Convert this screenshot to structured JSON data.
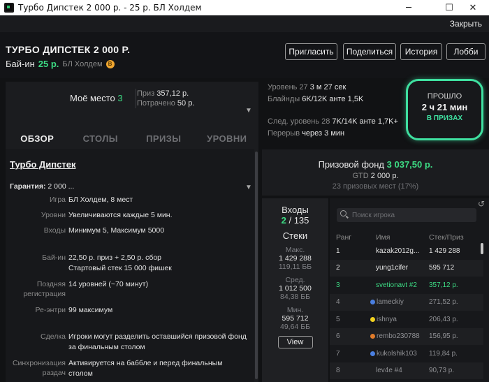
{
  "window": {
    "title": "Турбо Дипстек 2 000 р. - 25 р. БЛ Холдем",
    "min_symbol": "─",
    "max_symbol": "☐",
    "close_symbol": "✕"
  },
  "topbar": {
    "close_label": "Закрыть"
  },
  "header": {
    "title": "ТУРБО ДИПСТЕК 2 000 Р.",
    "buyin_label": "Бай-ин",
    "buyin_amount": "25 р.",
    "game": "БЛ Холдем",
    "coin_symbol": "B",
    "buttons": {
      "invite": "Пригласить",
      "share": "Поделиться",
      "history": "История",
      "lobby": "Лобби"
    }
  },
  "my_place": {
    "label": "Моё место",
    "place": "3",
    "prize_label": "Приз",
    "prize_value": "357,12 р.",
    "spent_label": "Потрачено",
    "spent_value": "50 р."
  },
  "tabs": [
    {
      "label": "ОБЗОР",
      "active": true
    },
    {
      "label": "СТОЛЫ",
      "active": false
    },
    {
      "label": "ПРИЗЫ",
      "active": false
    },
    {
      "label": "УРОВНИ",
      "active": false
    }
  ],
  "overview": {
    "title": "Турбо Дипстек",
    "guarantee_label": "Гарантия:",
    "guarantee_value": "2 000 ...",
    "rows": [
      {
        "key": "Игра",
        "value": "БЛ Холдем, 8 мест"
      },
      {
        "key": "Уровни",
        "value": "Увеличиваются каждые 5 мин."
      },
      {
        "key": "Входы",
        "value": "Минимум 5, Максимум 5000"
      },
      {
        "key": "Бай-ин",
        "value": "22,50 р. приз + 2,50 р. сбор",
        "value2": "Стартовый стек 15 000 фишек"
      },
      {
        "key": "Поздняя",
        "key2": "регистрация",
        "value": "14 уровней (~70 минут)"
      },
      {
        "key": "Ре-энтри",
        "value": "99 максимум"
      },
      {
        "key": "Сделка",
        "value": "Игроки могут разделить оставшийся призовой фонд",
        "value2": "за финальным столом"
      },
      {
        "key": "Синхронизация",
        "key2": "раздач",
        "value": "Активируется на баббле и перед финальным",
        "value2": "столом"
      }
    ]
  },
  "level_info": {
    "level_label": "Уровень",
    "level_num": "27",
    "level_time": "3 м 27 сек",
    "blinds_label": "Блайнды",
    "blinds_value": "6K/12K анте 1,5K",
    "next_label": "След. уровень",
    "next_num": "28",
    "next_value": "7K/14K анте 1,7K+",
    "break_label": "Перерыв",
    "break_value": "через 3 мин"
  },
  "elapsed": {
    "label": "ПРОШЛО",
    "time": "2 ч 21 мин",
    "status": "В ПРИЗАХ",
    "ring_color": "#3fe0a0"
  },
  "prize_pool": {
    "label": "Призовой фонд",
    "value": "3 037,50 р.",
    "gtd_label": "GTD",
    "gtd_value": "2 000 р.",
    "places": "23 призовых мест (17%)"
  },
  "stats": {
    "entries_label": "Входы",
    "entries_left": "2",
    "entries_total": "/ 135",
    "stacks_label": "Стеки",
    "max_label": "Макс.",
    "max_value": "1 429 288",
    "max_bb": "119,11 ББ",
    "avg_label": "Сред.",
    "avg_value": "1 012 500",
    "avg_bb": "84,38 ББ",
    "min_label": "Мин.",
    "min_value": "595 712",
    "min_bb": "49,64 ББ",
    "view_label": "View"
  },
  "players": {
    "search_placeholder": "Поиск игрока",
    "refresh_symbol": "↺",
    "headers": {
      "rank": "Ранг",
      "name": "Имя",
      "stack": "Стек/Приз"
    },
    "rows": [
      {
        "rank": "1",
        "name": "kazak2012g...",
        "stack": "1 429 288",
        "dot": ""
      },
      {
        "rank": "2",
        "name": "yung1cifer",
        "stack": "595 712",
        "dot": ""
      },
      {
        "rank": "3",
        "name": "svetionavt #2",
        "stack": "357,12 р.",
        "dot": ""
      },
      {
        "rank": "4",
        "name": "lameckiy",
        "stack": "271,52 р.",
        "dot": "#4a7fe0"
      },
      {
        "rank": "5",
        "name": "ishnya",
        "stack": "206,43 р.",
        "dot": "#f0d020"
      },
      {
        "rank": "6",
        "name": "rembo230788",
        "stack": "156,95 р.",
        "dot": "#e07b2a"
      },
      {
        "rank": "7",
        "name": "kukolshik103",
        "stack": "119,84 р.",
        "dot": "#4a7fe0"
      },
      {
        "rank": "8",
        "name": "lev4e #4",
        "stack": "90,73 р.",
        "dot": ""
      }
    ]
  }
}
